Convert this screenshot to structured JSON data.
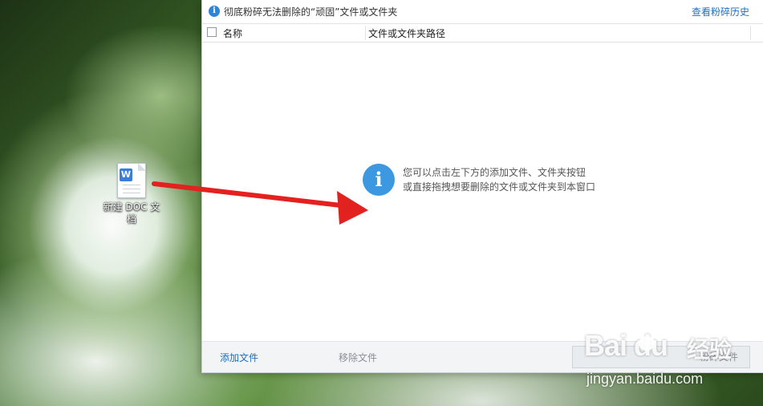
{
  "desktop": {
    "file_icon_label": "新建 DOC 文档",
    "file_badge": "W"
  },
  "window": {
    "title": "彻底粉碎无法删除的“顽固”文件或文件夹",
    "history_link": "查看粉碎历史",
    "table": {
      "columns": [
        "名称",
        "文件或文件夹路径"
      ]
    },
    "empty_hint": {
      "line1": "您可以点击左下方的添加文件、文件夹按钮",
      "line2": "或直接拖拽想要删除的文件或文件夹到本窗口"
    },
    "bottom": {
      "add_file": "添加文件",
      "remove_file": "移除文件",
      "shred_button": "粉碎文件"
    }
  },
  "watermark": {
    "logo": "Bai du",
    "jingyan": "经验",
    "url": "jingyan.baidu.com"
  },
  "colors": {
    "accent_blue": "#1d6fc4",
    "info_blue": "#3c98e0",
    "arrow_red": "#e3211f"
  },
  "icons": {
    "title_icon": "info-icon",
    "hint_icon": "info-icon",
    "file_icon": "word-document-icon"
  }
}
